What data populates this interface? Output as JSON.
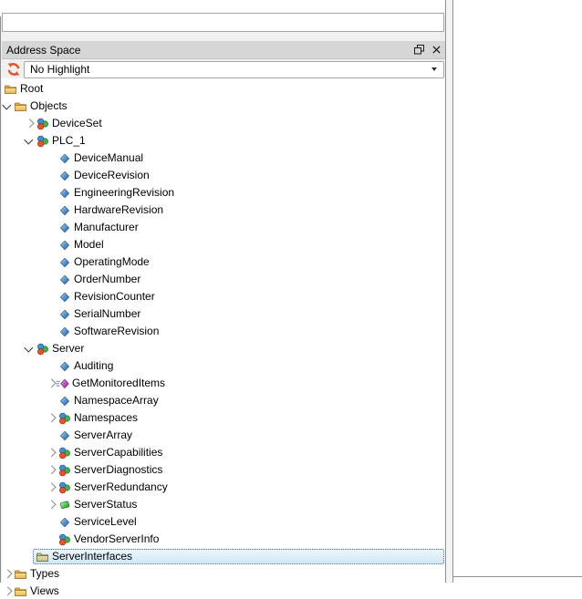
{
  "panel": {
    "title": "Address Space",
    "float_button": "float",
    "close_button": "close",
    "highlight_combo": {
      "value": "No Highlight"
    }
  },
  "tree": {
    "rows": [
      {
        "label": "Root",
        "depth": 0,
        "icon": "folder",
        "expander": "none"
      },
      {
        "label": "Objects",
        "depth": 1,
        "icon": "folder",
        "expander": "expanded"
      },
      {
        "label": "DeviceSet",
        "depth": 2,
        "icon": "object",
        "expander": "collapsed"
      },
      {
        "label": "PLC_1",
        "depth": 2,
        "icon": "object",
        "expander": "expanded"
      },
      {
        "label": "DeviceManual",
        "depth": 3,
        "icon": "property",
        "expander": "none"
      },
      {
        "label": "DeviceRevision",
        "depth": 3,
        "icon": "property",
        "expander": "none"
      },
      {
        "label": "EngineeringRevision",
        "depth": 3,
        "icon": "property",
        "expander": "none"
      },
      {
        "label": "HardwareRevision",
        "depth": 3,
        "icon": "property",
        "expander": "none"
      },
      {
        "label": "Manufacturer",
        "depth": 3,
        "icon": "property",
        "expander": "none"
      },
      {
        "label": "Model",
        "depth": 3,
        "icon": "property",
        "expander": "none"
      },
      {
        "label": "OperatingMode",
        "depth": 3,
        "icon": "property",
        "expander": "none"
      },
      {
        "label": "OrderNumber",
        "depth": 3,
        "icon": "property",
        "expander": "none"
      },
      {
        "label": "RevisionCounter",
        "depth": 3,
        "icon": "property",
        "expander": "none"
      },
      {
        "label": "SerialNumber",
        "depth": 3,
        "icon": "property",
        "expander": "none"
      },
      {
        "label": "SoftwareRevision",
        "depth": 3,
        "icon": "property",
        "expander": "none"
      },
      {
        "label": "Server",
        "depth": 2,
        "icon": "object",
        "expander": "expanded"
      },
      {
        "label": "Auditing",
        "depth": 3,
        "icon": "property",
        "expander": "none"
      },
      {
        "label": "GetMonitoredItems",
        "depth": 3,
        "icon": "method",
        "expander": "collapsed"
      },
      {
        "label": "NamespaceArray",
        "depth": 3,
        "icon": "property",
        "expander": "none"
      },
      {
        "label": "Namespaces",
        "depth": 3,
        "icon": "object",
        "expander": "collapsed"
      },
      {
        "label": "ServerArray",
        "depth": 3,
        "icon": "property",
        "expander": "none"
      },
      {
        "label": "ServerCapabilities",
        "depth": 3,
        "icon": "object",
        "expander": "collapsed"
      },
      {
        "label": "ServerDiagnostics",
        "depth": 3,
        "icon": "object",
        "expander": "collapsed"
      },
      {
        "label": "ServerRedundancy",
        "depth": 3,
        "icon": "object",
        "expander": "collapsed"
      },
      {
        "label": "ServerStatus",
        "depth": 3,
        "icon": "structure",
        "expander": "collapsed"
      },
      {
        "label": "ServiceLevel",
        "depth": 3,
        "icon": "property",
        "expander": "none"
      },
      {
        "label": "VendorServerInfo",
        "depth": 3,
        "icon": "object",
        "expander": "none"
      },
      {
        "label": "ServerInterfaces",
        "depth": 2,
        "icon": "folder-khaki",
        "expander": "none",
        "selected": true
      },
      {
        "label": "Types",
        "depth": 1,
        "icon": "folder",
        "expander": "collapsed"
      },
      {
        "label": "Views",
        "depth": 1,
        "icon": "folder",
        "expander": "collapsed"
      }
    ]
  },
  "colors": {
    "titlebar_bg": "#d6d6d6",
    "panel_bg": "#f0f0f0",
    "selection_fill": "#cfe7f7",
    "selection_border": "#49708e",
    "folder_yellow": "#f0c468",
    "object_blue": "#3f8fd1",
    "object_green": "#46b14c",
    "object_red": "#e2552b",
    "property_blue": "#2a6099",
    "method_purple": "#b43cb4",
    "structure_green": "#4fba4f",
    "highlight_icon_orange": "#e8541e"
  }
}
